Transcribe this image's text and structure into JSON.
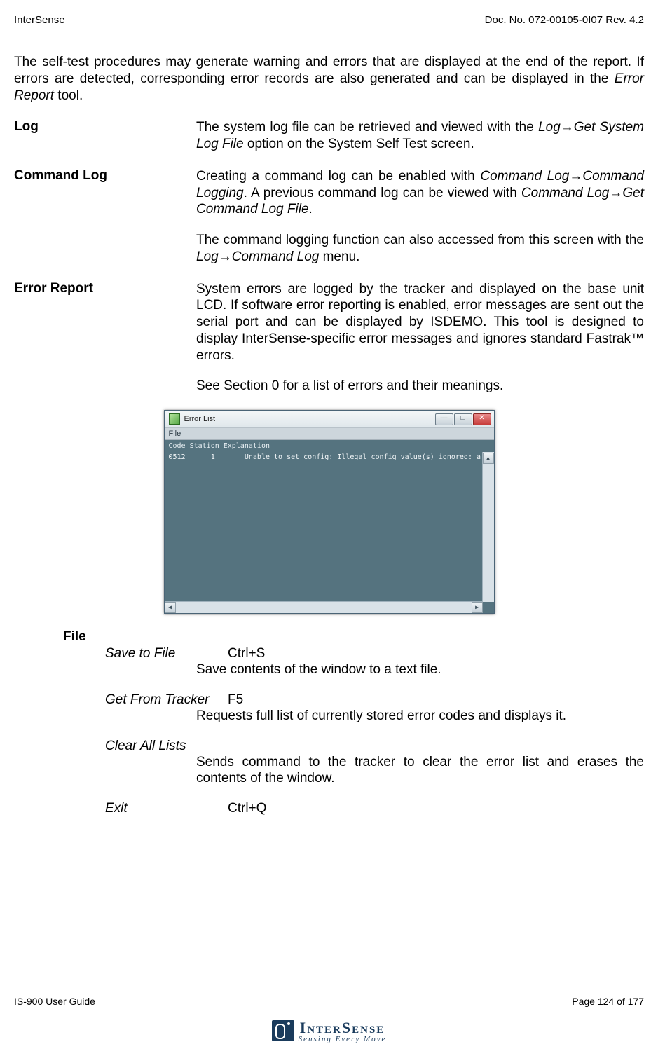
{
  "header": {
    "left": "InterSense",
    "right": "Doc. No. 072-00105-0I07 Rev. 4.2"
  },
  "intro": {
    "text": "The self-test procedures may generate warning and errors that are displayed at the end of the report.  If errors are detected, corresponding error records are also generated and can be displayed in the ",
    "italic": "Error Report",
    "tail": " tool."
  },
  "definitions": {
    "log": {
      "term": "Log",
      "body_pre": "The system log file can be retrieved and viewed with the ",
      "body_it": "Log→Get System Log File",
      "body_post": " option on the System Self Test screen."
    },
    "cmdlog": {
      "term": "Command Log",
      "p1_a": "Creating a command log can be enabled with ",
      "p1_it1": "Command Log→Command Logging",
      "p1_b": ". A previous command log can be viewed with ",
      "p1_it2": "Command Log→Get Command Log File",
      "p1_c": ".",
      "p2_a": "The command logging function can also accessed from this screen with the ",
      "p2_it": "Log→Command Log",
      "p2_b": " menu."
    },
    "err": {
      "term": "Error Report",
      "p1": "System errors are logged by the tracker and displayed on the base unit LCD.  If software error reporting is enabled, error messages are sent out the serial port and can be displayed by ISDEMO.  This tool is designed to display InterSense-specific error messages and ignores standard Fastrak™ errors.",
      "p2": "See Section 0 for a list of errors and their meanings."
    }
  },
  "error_window": {
    "title": "Error List",
    "menu": "File",
    "columns": "Code    Station   Explanation",
    "row": "0512      1       Unable to set config: Illegal config value(s) ignored: a"
  },
  "file_section": {
    "heading": "File",
    "items": [
      {
        "name": "Save to File",
        "shortcut": "Ctrl+S",
        "desc": "Save contents of the window to a text file."
      },
      {
        "name": "Get From Tracker",
        "shortcut": "F5",
        "desc": "Requests full list of currently stored error codes and displays it."
      },
      {
        "name": "Clear All Lists",
        "shortcut": "",
        "desc": "Sends command to the tracker to clear the error list and erases the contents of the window."
      },
      {
        "name": "Exit",
        "shortcut": "Ctrl+Q",
        "desc": ""
      }
    ]
  },
  "footer": {
    "left": "IS-900 User Guide",
    "right": "Page 124 of 177",
    "logo_main": "InterSense",
    "logo_sub": "Sensing Every Move"
  }
}
